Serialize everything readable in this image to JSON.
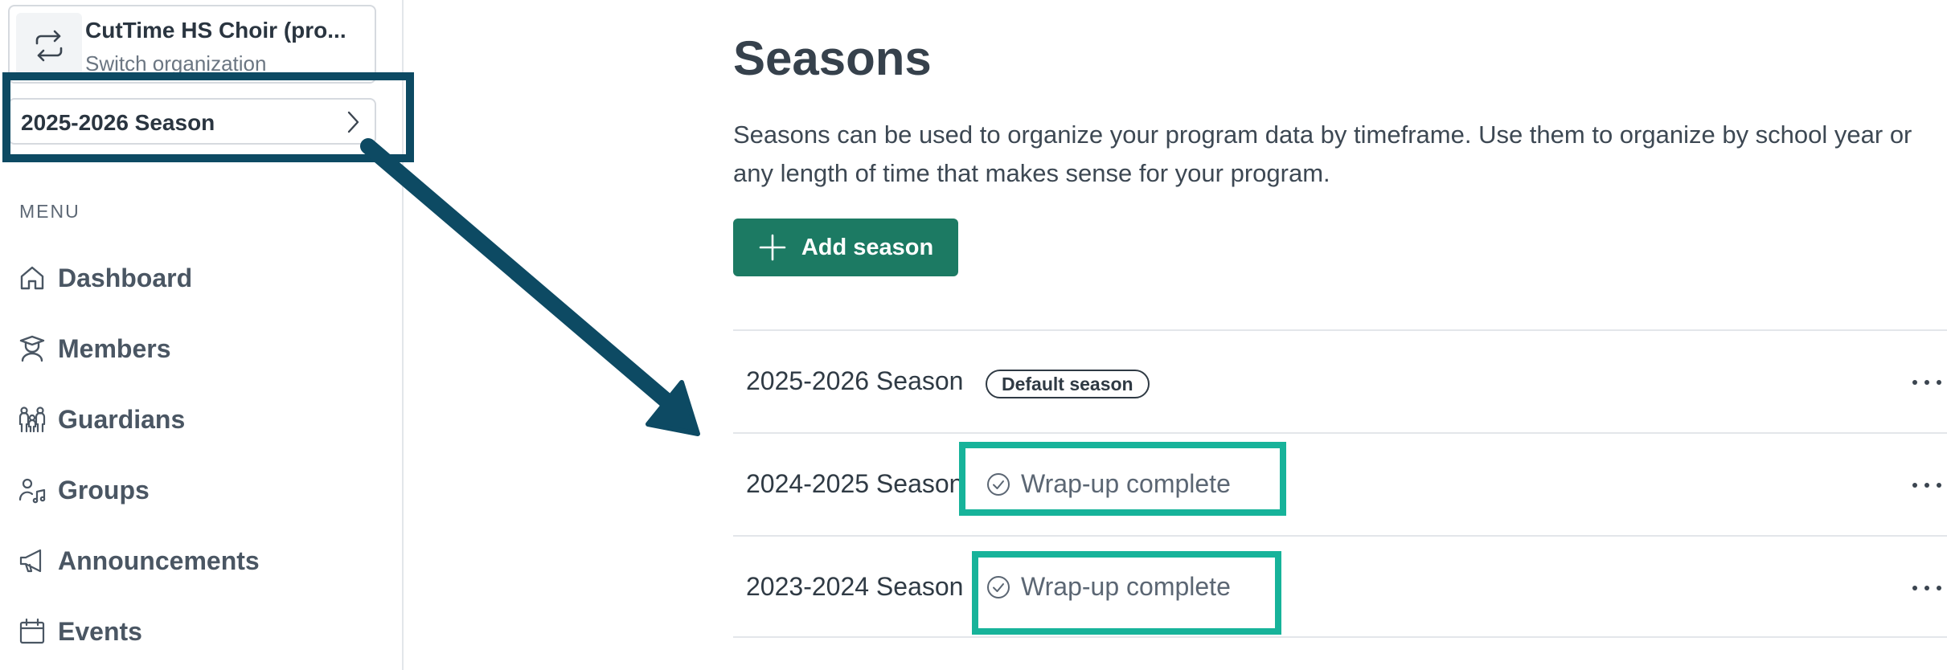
{
  "sidebar": {
    "org": {
      "name": "CutTime HS Choir (pro...",
      "subtitle": "Switch organization",
      "icon": "switch-arrows-icon"
    },
    "season_selector": {
      "label": "2025-2026 Season",
      "icon": "chevron-right-icon"
    },
    "menu_heading": "MENU",
    "items": [
      {
        "label": "Dashboard",
        "icon": "home-icon"
      },
      {
        "label": "Members",
        "icon": "graduate-icon"
      },
      {
        "label": "Guardians",
        "icon": "family-icon"
      },
      {
        "label": "Groups",
        "icon": "group-music-icon"
      },
      {
        "label": "Announcements",
        "icon": "megaphone-icon"
      },
      {
        "label": "Events",
        "icon": "calendar-icon"
      }
    ]
  },
  "main": {
    "title": "Seasons",
    "description": "Seasons can be used to organize your program data by timeframe. Use them to organize by school year or any length of time that makes sense for your program.",
    "add_button": "Add season",
    "seasons": [
      {
        "name": "2025-2026 Season",
        "badge": "Default season",
        "status": ""
      },
      {
        "name": "2024-2025 Season",
        "badge": "",
        "status": "Wrap-up complete"
      },
      {
        "name": "2023-2024 Season",
        "badge": "",
        "status": "Wrap-up complete"
      }
    ]
  },
  "colors": {
    "accent_green": "#1c7a63",
    "annotation_blue": "#0d4a63",
    "annotation_teal": "#17b39a"
  }
}
